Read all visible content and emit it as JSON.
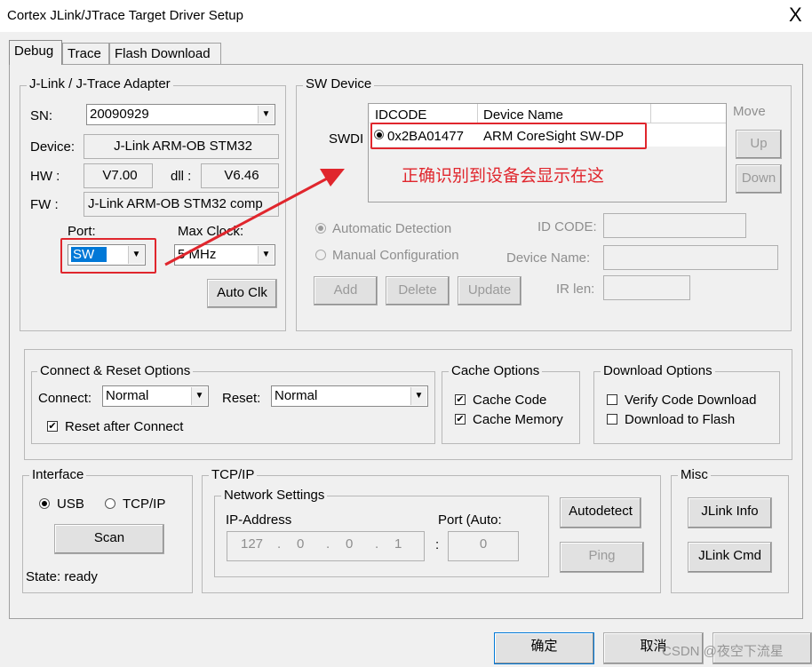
{
  "window": {
    "title": "Cortex JLink/JTrace Target Driver Setup",
    "close": "X"
  },
  "tabs": [
    {
      "label": "Debug"
    },
    {
      "label": "Trace"
    },
    {
      "label": "Flash Download"
    }
  ],
  "adapter": {
    "group_title": "J-Link / J-Trace Adapter",
    "sn_label": "SN:",
    "sn_value": "20090929",
    "device_label": "Device:",
    "device_value": "J-Link ARM-OB STM32",
    "hw_label": "HW :",
    "hw_value": "V7.00",
    "dll_label": "dll :",
    "dll_value": "V6.46",
    "fw_label": "FW :",
    "fw_value": "J-Link ARM-OB STM32 comp",
    "port_label": "Port:",
    "port_value": "SW",
    "maxclock_label": "Max Clock:",
    "maxclock_value": "5 MHz",
    "autoclk_label": "Auto Clk"
  },
  "sw_device": {
    "group_title": "SW Device",
    "swdi_label": "SWDI",
    "col_idcode": "IDCODE",
    "col_device_name": "Device Name",
    "row_idcode": "0x2BA01477",
    "row_device_name": "ARM CoreSight SW-DP",
    "move_label": "Move",
    "up_label": "Up",
    "down_label": "Down",
    "auto_detect_label": "Automatic Detection",
    "manual_config_label": "Manual Configuration",
    "idcode_label": "ID CODE:",
    "device_name_label": "Device Name:",
    "ir_len_label": "IR len:",
    "add_label": "Add",
    "delete_label": "Delete",
    "update_label": "Update",
    "annotation": "正确识别到设备会显示在这"
  },
  "connect_reset": {
    "group_title": "Connect & Reset Options",
    "connect_label": "Connect:",
    "connect_value": "Normal",
    "reset_label": "Reset:",
    "reset_value": "Normal",
    "reset_after_connect_label": "Reset after Connect",
    "reset_after_connect_checked": true
  },
  "cache": {
    "group_title": "Cache Options",
    "cache_code_label": "Cache Code",
    "cache_code_checked": true,
    "cache_memory_label": "Cache Memory",
    "cache_memory_checked": true
  },
  "download": {
    "group_title": "Download Options",
    "verify_label": "Verify Code Download",
    "verify_checked": false,
    "flash_label": "Download to Flash",
    "flash_checked": false
  },
  "interface": {
    "group_title": "Interface",
    "usb_label": "USB",
    "tcpip_label": "TCP/IP",
    "selected": "USB",
    "scan_label": "Scan",
    "state_text": "State: ready"
  },
  "tcpip": {
    "group_title": "TCP/IP",
    "network_settings_title": "Network Settings",
    "ip_label": "IP-Address",
    "port_label": "Port (Auto:",
    "ip1": "127",
    "ip2": "0",
    "ip3": "0",
    "ip4": "1",
    "port_value": "0",
    "autodetect_label": "Autodetect",
    "ping_label": "Ping"
  },
  "misc": {
    "group_title": "Misc",
    "jlink_info_label": "JLink Info",
    "jlink_cmd_label": "JLink Cmd"
  },
  "footer": {
    "ok_label": "确定",
    "cancel_label": "取消",
    "watermark": "CSDN @夜空下流星"
  },
  "colors": {
    "annotation_red": "#e0262d",
    "selection_blue": "#0078d7"
  }
}
